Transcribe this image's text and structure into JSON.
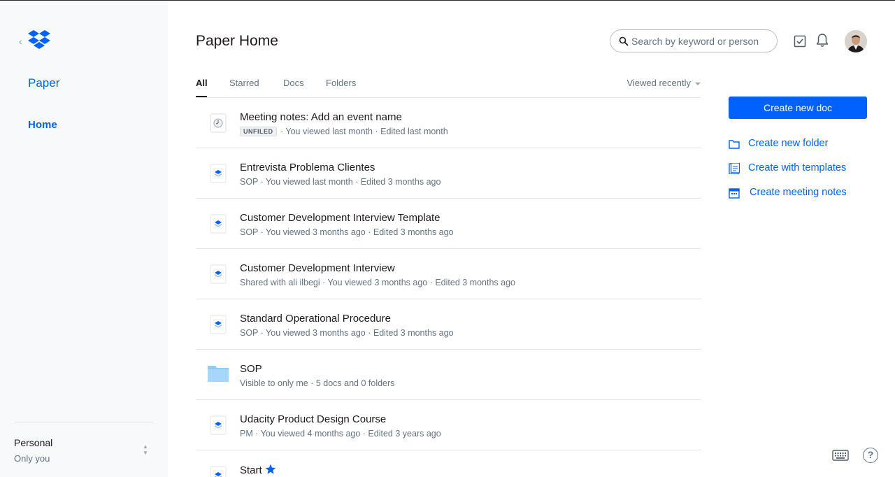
{
  "sidebar": {
    "back_glyph": "‹",
    "logo_icon": "dropbox-logo-icon",
    "product": "Paper",
    "nav_home": "Home",
    "account_name": "Personal",
    "account_scope": "Only you"
  },
  "header": {
    "title": "Paper Home",
    "search_placeholder": "Search by keyword or person"
  },
  "tabs": [
    {
      "label": "All",
      "active": true
    },
    {
      "label": "Starred",
      "active": false
    },
    {
      "label": "Docs",
      "active": false
    },
    {
      "label": "Folders",
      "active": false
    }
  ],
  "sort_label": "Viewed recently",
  "items": [
    {
      "icon": "meeting-notes-icon",
      "title": "Meeting notes: Add an event name",
      "badge": "UNFILED",
      "meta": " · You viewed last month · Edited last month"
    },
    {
      "icon": "paper-doc-icon",
      "title": "Entrevista Problema Clientes",
      "meta": "SOP · You viewed last month · Edited 3 months ago"
    },
    {
      "icon": "paper-doc-icon",
      "title": "Customer Development Interview Template",
      "meta": "SOP · You viewed 3 months ago · Edited 3 months ago"
    },
    {
      "icon": "paper-doc-icon",
      "title": "Customer Development Interview",
      "meta": "Shared with ali ilbegi · You viewed 3 months ago · Edited 3 months ago"
    },
    {
      "icon": "paper-doc-icon",
      "title": "Standard Operational Procedure",
      "meta": "SOP · You viewed 3 months ago · Edited 3 months ago"
    },
    {
      "icon": "folder-icon",
      "title": "SOP",
      "meta": "Visible to only me · 5 docs and 0 folders"
    },
    {
      "icon": "paper-doc-icon",
      "title": "Udacity Product Design Course",
      "meta": "PM · You viewed 4 months ago · Edited 3 years ago"
    },
    {
      "icon": "paper-doc-icon",
      "title": "Start",
      "starred": true,
      "meta": ""
    }
  ],
  "actions": {
    "create_doc": "Create new doc",
    "create_folder": "Create new folder",
    "create_templates": "Create with templates",
    "create_meeting": "Create meeting notes"
  },
  "footer": {
    "help_glyph": "?"
  },
  "colors": {
    "accent": "#0061fe",
    "sidebar_bg": "#f7f9fa",
    "muted_text": "#637282",
    "folder": "#8ecbf9"
  }
}
